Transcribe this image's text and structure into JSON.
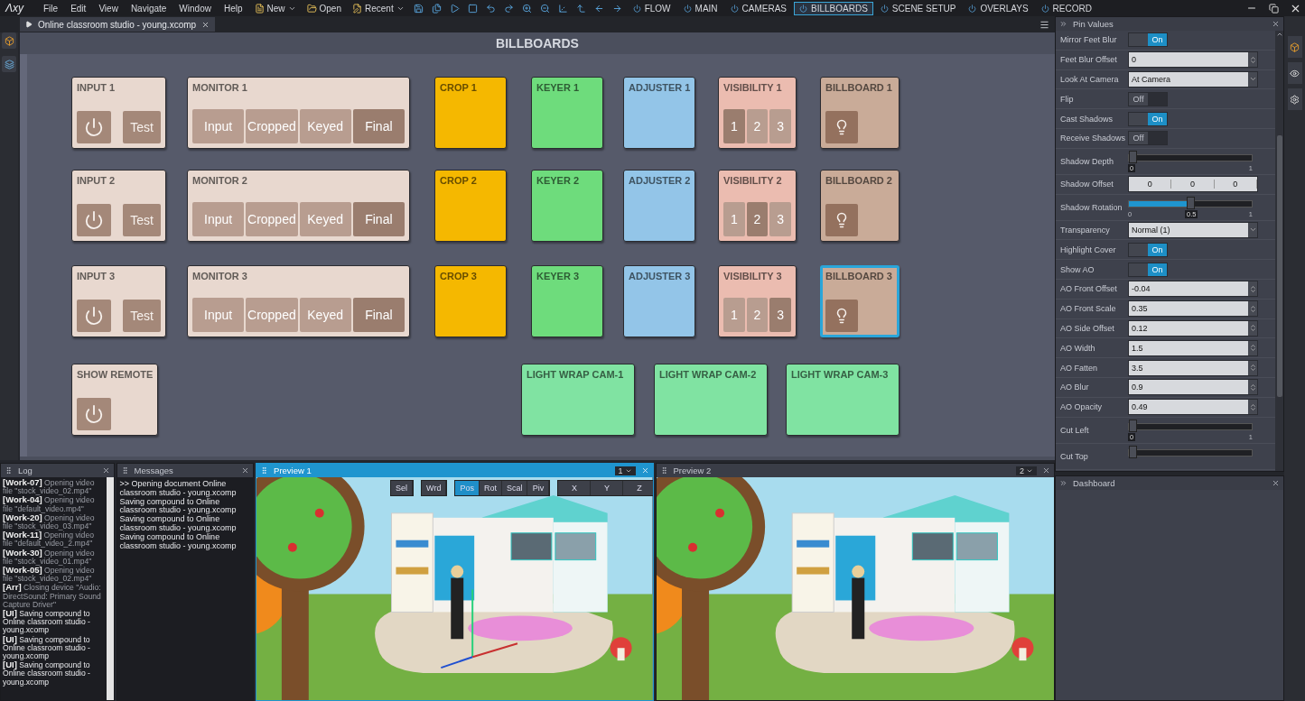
{
  "window": {
    "logo": "Λxy",
    "menu": [
      "File",
      "Edit",
      "View",
      "Navigate",
      "Window",
      "Help"
    ],
    "toolbar": [
      {
        "label": "New",
        "kind": "new"
      },
      {
        "label": "Open",
        "kind": "open"
      },
      {
        "label": "Recent",
        "kind": "recent"
      }
    ],
    "boards": [
      {
        "label": "FLOW",
        "selected": false
      },
      {
        "label": "MAIN",
        "selected": false
      },
      {
        "label": "CAMERAS",
        "selected": false
      },
      {
        "label": "BILLBOARDS",
        "selected": true
      },
      {
        "label": "SCENE SETUP",
        "selected": false
      },
      {
        "label": "OVERLAYS",
        "selected": false
      },
      {
        "label": "RECORD",
        "selected": false
      }
    ]
  },
  "document": {
    "tab": "Online classroom studio - young.xcomp",
    "title": "BILLBOARDS",
    "tiles": [
      {
        "title": "INPUT 1",
        "kind": "input",
        "color": "#e8d8cf",
        "selected": false,
        "buttons": [
          {
            "label": "Test"
          }
        ]
      },
      {
        "title": "MONITOR 1",
        "kind": "monitor",
        "color": "#e8d8cf",
        "selected": false,
        "buttons": [
          {
            "label": "Input",
            "selected": false
          },
          {
            "label": "Cropped",
            "selected": false
          },
          {
            "label": "Keyed",
            "selected": false
          },
          {
            "label": "Final",
            "selected": true
          }
        ]
      },
      {
        "title": "CROP 1",
        "kind": "plain",
        "color": "#f5b800",
        "selected": false
      },
      {
        "title": "KEYER 1",
        "kind": "plain",
        "color": "#6edc7c",
        "selected": false
      },
      {
        "title": "ADJUSTER 1",
        "kind": "plain",
        "color": "#93c5e8",
        "selected": false
      },
      {
        "title": "VISIBILITY 1",
        "kind": "visibility",
        "color": "#ebbcb0",
        "selected": false,
        "buttons": [
          {
            "label": "1",
            "selected": true
          },
          {
            "label": "2",
            "selected": false
          },
          {
            "label": "3",
            "selected": false
          }
        ]
      },
      {
        "title": "BILLBOARD 1",
        "kind": "billboard",
        "color": "#c9ab98",
        "selected": false
      },
      {
        "title": "INPUT 2",
        "kind": "input",
        "color": "#e8d8cf",
        "selected": false,
        "buttons": [
          {
            "label": "Test"
          }
        ]
      },
      {
        "title": "MONITOR 2",
        "kind": "monitor",
        "color": "#e8d8cf",
        "selected": false,
        "buttons": [
          {
            "label": "Input",
            "selected": false
          },
          {
            "label": "Cropped",
            "selected": false
          },
          {
            "label": "Keyed",
            "selected": false
          },
          {
            "label": "Final",
            "selected": true
          }
        ]
      },
      {
        "title": "CROP 2",
        "kind": "plain",
        "color": "#f5b800",
        "selected": false
      },
      {
        "title": "KEYER 2",
        "kind": "plain",
        "color": "#6edc7c",
        "selected": false
      },
      {
        "title": "ADJUSTER 2",
        "kind": "plain",
        "color": "#93c5e8",
        "selected": false
      },
      {
        "title": "VISIBILITY 2",
        "kind": "visibility",
        "color": "#ebbcb0",
        "selected": false,
        "buttons": [
          {
            "label": "1",
            "selected": false
          },
          {
            "label": "2",
            "selected": true
          },
          {
            "label": "3",
            "selected": false
          }
        ]
      },
      {
        "title": "BILLBOARD 2",
        "kind": "billboard",
        "color": "#c9ab98",
        "selected": false
      },
      {
        "title": "INPUT 3",
        "kind": "input",
        "color": "#e8d8cf",
        "selected": false,
        "buttons": [
          {
            "label": "Test"
          }
        ]
      },
      {
        "title": "MONITOR 3",
        "kind": "monitor",
        "color": "#e8d8cf",
        "selected": false,
        "buttons": [
          {
            "label": "Input",
            "selected": false
          },
          {
            "label": "Cropped",
            "selected": false
          },
          {
            "label": "Keyed",
            "selected": false
          },
          {
            "label": "Final",
            "selected": true
          }
        ]
      },
      {
        "title": "CROP 3",
        "kind": "plain",
        "color": "#f5b800",
        "selected": false
      },
      {
        "title": "KEYER 3",
        "kind": "plain",
        "color": "#6edc7c",
        "selected": false
      },
      {
        "title": "ADJUSTER 3",
        "kind": "plain",
        "color": "#93c5e8",
        "selected": false
      },
      {
        "title": "VISIBILITY 3",
        "kind": "visibility",
        "color": "#ebbcb0",
        "selected": false,
        "buttons": [
          {
            "label": "1",
            "selected": false
          },
          {
            "label": "2",
            "selected": false
          },
          {
            "label": "3",
            "selected": true
          }
        ]
      },
      {
        "title": "BILLBOARD 3",
        "kind": "billboard",
        "color": "#c9ab98",
        "selected": true
      },
      {
        "title": "SHOW REMOTE",
        "kind": "power",
        "color": "#e8d8cf",
        "selected": false
      },
      {
        "title": "LIGHT WRAP CAM-1",
        "kind": "plain",
        "color": "#80e3a2",
        "selected": false
      },
      {
        "title": "LIGHT WRAP CAM-2",
        "kind": "plain",
        "color": "#80e3a2",
        "selected": false
      },
      {
        "title": "LIGHT WRAP CAM-3",
        "kind": "plain",
        "color": "#80e3a2",
        "selected": false
      }
    ]
  },
  "pins": {
    "title": "Pin Values",
    "rows": [
      {
        "label": "Mirror Feet Blur",
        "kind": "toggle",
        "on": true,
        "text": "On"
      },
      {
        "label": "Feet Blur Offset",
        "kind": "number",
        "value": "0"
      },
      {
        "label": "Look At Camera",
        "kind": "select",
        "value": "At Camera"
      },
      {
        "label": "Flip",
        "kind": "toggle",
        "on": false,
        "text": "Off"
      },
      {
        "label": "Cast Shadows",
        "kind": "toggle",
        "on": true,
        "text": "On"
      },
      {
        "label": "Receive Shadows",
        "kind": "toggle",
        "on": false,
        "text": "Off"
      },
      {
        "label": "Shadow Depth",
        "kind": "slider",
        "level": 0,
        "reading": "0",
        "max": "1"
      },
      {
        "label": "Shadow Offset",
        "kind": "vector",
        "values": [
          "0",
          "0",
          "0"
        ]
      },
      {
        "label": "Shadow Rotation",
        "kind": "slider",
        "level": 0.5,
        "min": "0",
        "reading": "0.5",
        "max": "1"
      },
      {
        "label": "Transparency",
        "kind": "select",
        "value": "Normal (1)"
      },
      {
        "label": "Highlight Cover",
        "kind": "toggle",
        "on": true,
        "text": "On"
      },
      {
        "label": "Show AO",
        "kind": "toggle",
        "on": true,
        "text": "On"
      },
      {
        "label": "AO Front Offset",
        "kind": "number",
        "value": "-0.04"
      },
      {
        "label": "AO Front Scale",
        "kind": "number",
        "value": "0.35"
      },
      {
        "label": "AO Side Offset",
        "kind": "number",
        "value": "0.12"
      },
      {
        "label": "AO Width",
        "kind": "number",
        "value": "1.5"
      },
      {
        "label": "AO Fatten",
        "kind": "number",
        "value": "3.5"
      },
      {
        "label": "AO Blur",
        "kind": "number",
        "value": "0.9"
      },
      {
        "label": "AO Opacity",
        "kind": "number",
        "value": "0.49"
      },
      {
        "label": "Cut Left",
        "kind": "slider",
        "level": 0,
        "reading": "0",
        "max": "1"
      },
      {
        "label": "Cut Top",
        "kind": "slider",
        "level": 0
      }
    ]
  },
  "dashboard": {
    "title": "Dashboard"
  },
  "log": {
    "title": "Log",
    "entries": [
      {
        "text": "**[Work-07]** Opening video file \"stock_video_02.mp4\"",
        "dim": true
      },
      {
        "text": "**[Work-04]** Opening video file \"default_video.mp4\"",
        "dim": true
      },
      {
        "text": "**[Work-20]** Opening video file \"stock_video_03.mp4\"",
        "dim": true
      },
      {
        "text": "**[Work-11]** Opening video file \"default_video_2.mp4\"",
        "dim": true
      },
      {
        "text": "**[Work-30]** Opening video file \"stock_video_01.mp4\"",
        "dim": true
      },
      {
        "text": "**[Work-05]** Opening video file \"stock_video_02.mp4\"",
        "dim": true
      },
      {
        "text": "**[Arr]** Closing device \"Audio: DirectSound: Primary Sound Capture Driver\"",
        "dim": true
      },
      {
        "text": "**[UI]** Saving compound to Online classroom studio - young.xcomp",
        "dim": false
      },
      {
        "text": "**[UI]** Saving compound to Online classroom studio - young.xcomp",
        "dim": false
      },
      {
        "text": "**[UI]** Saving compound to Online classroom studio - young.xcomp",
        "dim": false
      }
    ]
  },
  "messages": {
    "title": "Messages",
    "lines": [
      ">> Opening document Online classroom studio - young.xcomp",
      "Saving compound to Online classroom studio - young.xcomp",
      "Saving compound to Online classroom studio - young.xcomp",
      "Saving compound to Online classroom studio - young.xcomp"
    ]
  },
  "previews": [
    {
      "title": "Preview 1",
      "selected": true,
      "channel": "1",
      "gizmo": true,
      "tools": [
        [
          {
            "label": "Sel",
            "selected": false
          }
        ],
        [
          {
            "label": "Wrd",
            "selected": false
          }
        ],
        [
          {
            "label": "Pos",
            "selected": true
          },
          {
            "label": "Rot",
            "selected": false
          },
          {
            "label": "Scal",
            "selected": false
          },
          {
            "label": "Piv",
            "selected": false
          }
        ],
        [
          {
            "label": "X",
            "selected": false
          },
          {
            "label": "Y",
            "selected": false
          },
          {
            "label": "Z",
            "selected": false
          }
        ]
      ]
    },
    {
      "title": "Preview 2",
      "selected": false,
      "channel": "2",
      "gizmo": false
    }
  ]
}
